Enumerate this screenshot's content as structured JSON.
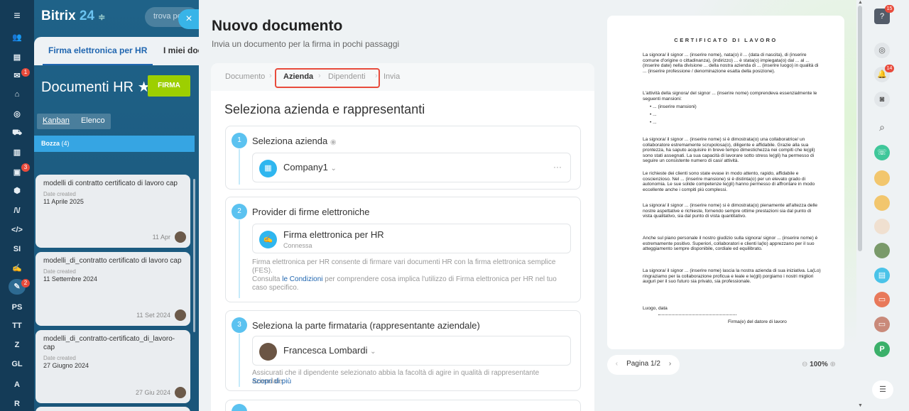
{
  "app": {
    "logo_text": "Bitrix",
    "logo_num": "24",
    "search_placeholder": "trova pe"
  },
  "left_nav": {
    "items": [
      "SI",
      "PS",
      "TT",
      "Z",
      "GL",
      "A",
      "R"
    ],
    "badges": [
      "1",
      "3",
      "2"
    ]
  },
  "background_tabs": {
    "tab1": "Firma elettronica per HR",
    "tab2": "I miei doc"
  },
  "background_page": {
    "title": "Documenti HR",
    "firma_button": "FIRMA",
    "view_kanban": "Kanban",
    "view_elenco": "Elenco",
    "column": "Bozza",
    "column_count": "(4)",
    "cards": [
      {
        "title": "modelli di contratto certificato di lavoro cap",
        "date_label": "Date created",
        "date": "11 Aprile 2025",
        "short": "11 Apr"
      },
      {
        "title": "modelli_di_contratto certificato di lavoro cap",
        "date_label": "Date created",
        "date": "11 Settembre 2024",
        "short": "11 Set 2024"
      },
      {
        "title": "modelli_di_contratto-certificato_di_lavoro-cap",
        "date_label": "Date created",
        "date": "27 Giugno 2024",
        "short": "27 Giu 2024"
      }
    ]
  },
  "slider": {
    "close": "×",
    "title": "Nuovo documento",
    "subtitle": "Invia un documento per la firma in pochi passaggi",
    "steps": [
      "Documento",
      "Azienda",
      "Dipendenti",
      "Invia"
    ],
    "page_title": "Seleziona azienda e rappresentanti",
    "sections": [
      {
        "num": "1",
        "title": "Seleziona azienda",
        "value": "Company1",
        "more": "···"
      },
      {
        "num": "2",
        "title": "Provider di firme elettroniche",
        "value": "Firma elettronica per HR",
        "value_sub": "Connessa",
        "desc": "Firma elettronica per HR consente di firmare vari documenti HR con la firma elettronica semplice (FES).",
        "desc2_pre": "Consulta ",
        "desc2_link": "le Condizioni",
        "desc2_post": " per comprendere cosa implica l'utilizzo di Firma elettronica per HR nel tuo caso specifico."
      },
      {
        "num": "3",
        "title": "Seleziona la parte firmataria (rappresentante aziendale)",
        "value": "Francesca Lombardi",
        "desc": "Assicurati che il dipendente selezionato abbia la facoltà di agire in qualità di rappresentante aziendale.",
        "link": "Scopri di più"
      }
    ]
  },
  "preview": {
    "heading": "CERTIFICATO DI LAVORO",
    "p1": "La signora/ il signor ... (inserire nome), nata(o) il ... (data di nascita), di (inserire comune d'origine o cittadinanza), (indirizzo) ... è stata(o) impiegata(o) dal ... al ... (inserire date) nella divisione ... della nostra azienda di ... (inserire luogo) in qualità di ... (inserire professione / denominazione esatta della posizione).",
    "p2": "L'attività della signora/ del signor ... (inserire nome) comprendeva essenzialmente le seguenti mansioni:",
    "bullets": [
      "... (inserire mansioni)",
      "...",
      "..."
    ],
    "p3": "La signora/ il signor ... (inserire nome) si è dimostrata(o) una collaboratrice/ un collaboratore estremamente scrupolosa(o), diligente e affidabile. Grazie alla sua prontezza, ha saputo acquisire in breve tempo dimestichezza nei compiti che le(gli) sono stati assegnati. La sua capacità di lavorare sotto stress le(gli) ha permesso di seguire un consistente numero di casi/ attività.",
    "p4": "Le richieste dei clienti sono state evase in modo attento, rapido, affidabile e coscienzioso. Nel ... (inserire mansione) si è distinta(o) per un elevato grado di autonomia. Le sue solide competenze le(gli) hanno permesso di affrontare in modo eccellente anche i compiti più complessi.",
    "p5": "La signora/ il signor ... (inserire nome) si è dimostrata(o) pienamente all'altezza delle nostre aspettative e richieste, fornendo sempre ottime prestazioni sia dal punto di vista qualitativo, sia dal punto di vista quantitativo.",
    "p6": "Anche sul piano personale il nostro giudizio sulla signora/ signor ... (inserire nome) è estremamente positivo. Superiori, collaboratori e clienti la(lo) apprezzano per il suo atteggiamento sempre disponibile, cordiale ed equilibrato.",
    "p7": "La signora/ il signor ... (inserire nome) lascia la nostra azienda di sua iniziativa. La(Lo) ringraziamo per la collaborazione proficua e leale e le(gli) porgiamo i nostri migliori auguri per il suo futuro sia privato, sia professionale.",
    "place": "Luogo, data",
    "signature": "Firma(e) del datore di lavoro",
    "pager": "Pagina 1/2",
    "zoom": "100%"
  },
  "right_bar": {
    "badge_top": "15",
    "badge_bell": "14",
    "p_avatar": "P"
  }
}
